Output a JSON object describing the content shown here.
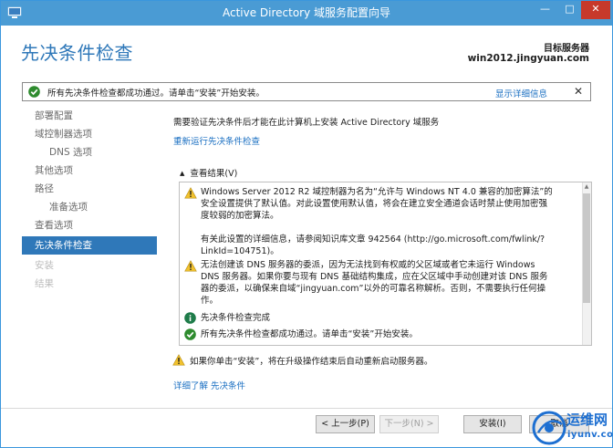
{
  "window": {
    "title": "Active Directory 域服务配置向导",
    "minimize_glyph": "—",
    "maximize_glyph": "□",
    "close_glyph": "✕"
  },
  "header": {
    "page_title": "先决条件检查",
    "target_server_label": "目标服务器",
    "target_server_value": "win2012.jingyuan.com"
  },
  "notification": {
    "message": "所有先决条件检查都成功通过。请单击“安装”开始安装。",
    "show_details": "显示详细信息",
    "close_glyph": "✕"
  },
  "sidebar": {
    "items": [
      {
        "label": "部署配置",
        "state": "normal",
        "level": 0
      },
      {
        "label": "域控制器选项",
        "state": "normal",
        "level": 0
      },
      {
        "label": "DNS 选项",
        "state": "normal",
        "level": 1
      },
      {
        "label": "其他选项",
        "state": "normal",
        "level": 0
      },
      {
        "label": "路径",
        "state": "normal",
        "level": 0
      },
      {
        "label": "准备选项",
        "state": "normal",
        "level": 1
      },
      {
        "label": "查看选项",
        "state": "normal",
        "level": 0
      },
      {
        "label": "先决条件检查",
        "state": "active",
        "level": 0
      },
      {
        "label": "安装",
        "state": "disabled",
        "level": 0
      },
      {
        "label": "结果",
        "state": "disabled",
        "level": 0
      }
    ]
  },
  "content": {
    "intro": "需要验证先决条件后才能在此计算机上安装 Active Directory 域服务",
    "rerun_link": "重新运行先决条件检查",
    "results_header": "查看结果(V)",
    "results": [
      {
        "icon": "warning",
        "lines": [
          "Windows Server 2012 R2 域控制器为名为“允许与 Windows NT 4.0 兼容的加密算法”的",
          "安全设置提供了默认值。对此设置使用默认值，将会在建立安全通道会话时禁止使用加密强",
          "度较弱的加密算法。",
          "",
          "有关此设置的详细信息，请参阅知识库文章 942564 (http://go.microsoft.com/fwlink/?",
          "LinkId=104751)。"
        ]
      },
      {
        "icon": "warning",
        "lines": [
          "无法创建该 DNS 服务器的委派，因为无法找到有权威的父区域或者它未运行 Windows",
          "DNS 服务器。如果你要与现有 DNS 基础结构集成，应在父区域中手动创建对该 DNS 服务",
          "器的委派，以确保来自域“jingyuan.com”以外的可靠名称解析。否则，不需要执行任何操",
          "作。"
        ]
      },
      {
        "icon": "info",
        "lines": [
          "先决条件检查完成"
        ]
      },
      {
        "icon": "success",
        "lines": [
          "所有先决条件检查都成功通过。请单击“安装”开始安装。"
        ]
      }
    ],
    "footnote": "如果你单击“安装”，将在升级操作结束后自动重新启动服务器。",
    "learn_more": "详细了解 先决条件"
  },
  "buttons": {
    "previous": "< 上一步(P)",
    "next": "下一步(N) >",
    "install": "安装(I)",
    "cancel": "取消"
  },
  "watermark": {
    "text": "运维网",
    "sub": "iyunv.com"
  },
  "colors": {
    "titlebar": "#4a9bd4",
    "accent": "#2f78b9",
    "link": "#1a6fc2",
    "success": "#2e8b2e",
    "warning": "#f2c22e",
    "info": "#1f7c4a"
  }
}
